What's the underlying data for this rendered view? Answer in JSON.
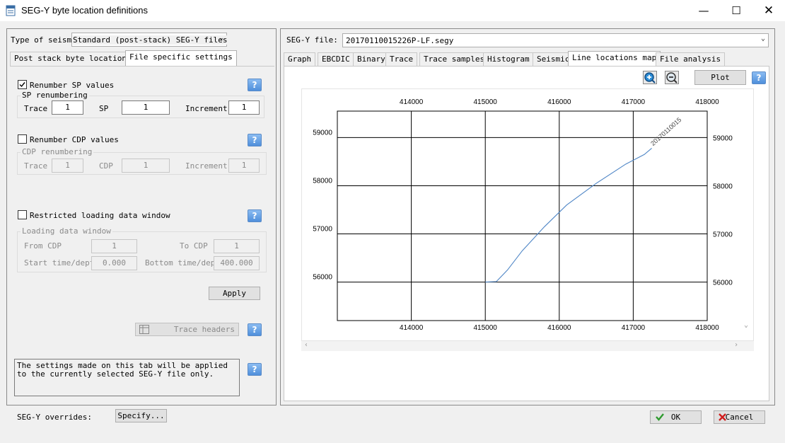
{
  "window": {
    "title": "SEG-Y byte location definitions"
  },
  "left": {
    "type_label": "Type of seismic",
    "type_value": "Standard (post-stack) SEG-Y files",
    "tabs": [
      {
        "label": "Post stack byte locations"
      },
      {
        "label": "File specific settings"
      }
    ],
    "renumber_sp": {
      "label": "Renumber SP values",
      "checked": true
    },
    "sp_group": {
      "title": "SP renumbering",
      "trace_label": "Trace",
      "trace": "1",
      "sp_label": "SP",
      "sp": "1",
      "inc_label": "Increment",
      "inc": "1"
    },
    "renumber_cdp": {
      "label": "Renumber CDP values",
      "checked": false
    },
    "cdp_group": {
      "title": "CDP renumbering",
      "trace_label": "Trace",
      "trace": "1",
      "cdp_label": "CDP",
      "cdp": "1",
      "inc_label": "Increment",
      "inc": "1"
    },
    "restricted": {
      "label": "Restricted loading data window",
      "checked": false
    },
    "window_group": {
      "title": "Loading data window",
      "from_cdp_label": "From CDP",
      "from_cdp": "1",
      "to_cdp_label": "To CDP",
      "to_cdp": "1",
      "start_label": "Start time/depth",
      "start": "0.000",
      "bottom_label": "Bottom time/depth",
      "bottom": "400.000"
    },
    "apply_label": "Apply",
    "trace_headers_label": "Trace headers",
    "note": "The settings made on this tab will be applied to the currently selected SEG-Y file only.",
    "help_glyph": "?"
  },
  "footer": {
    "overrides_label": "SEG-Y overrides:",
    "specify_label": "Specify...",
    "ok_label": "OK",
    "cancel_label": "Cancel"
  },
  "right": {
    "file_label": "SEG-Y file:",
    "file_value": "20170110015226P-LF.segy",
    "tabs": [
      {
        "label": "Graph"
      },
      {
        "label": "EBCDIC"
      },
      {
        "label": "Binary"
      },
      {
        "label": "Trace"
      },
      {
        "label": "Trace samples"
      },
      {
        "label": "Histogram"
      },
      {
        "label": "Seismic"
      },
      {
        "label": "Line locations map"
      },
      {
        "label": "File analysis"
      }
    ],
    "active_tab": 7,
    "plot_label": "Plot",
    "zoom_in_glyph": "+",
    "zoom_out_glyph": "−",
    "help_glyph": "?"
  },
  "chart_data": {
    "type": "line",
    "x_ticks": [
      "414000",
      "415000",
      "416000",
      "417000",
      "418000"
    ],
    "y_ticks": [
      "59000",
      "58000",
      "57000",
      "56000"
    ],
    "xlim": [
      413000,
      418000
    ],
    "ylim": [
      55200,
      59550
    ],
    "grid": true,
    "series": [
      {
        "name": "20170110015",
        "color": "#4f86c6",
        "x": [
          415000,
          415150,
          415300,
          415500,
          415800,
          416100,
          416500,
          416900,
          417150,
          417250
        ],
        "y": [
          56000,
          56010,
          56250,
          56650,
          57150,
          57600,
          58050,
          58450,
          58650,
          58780
        ]
      }
    ]
  }
}
